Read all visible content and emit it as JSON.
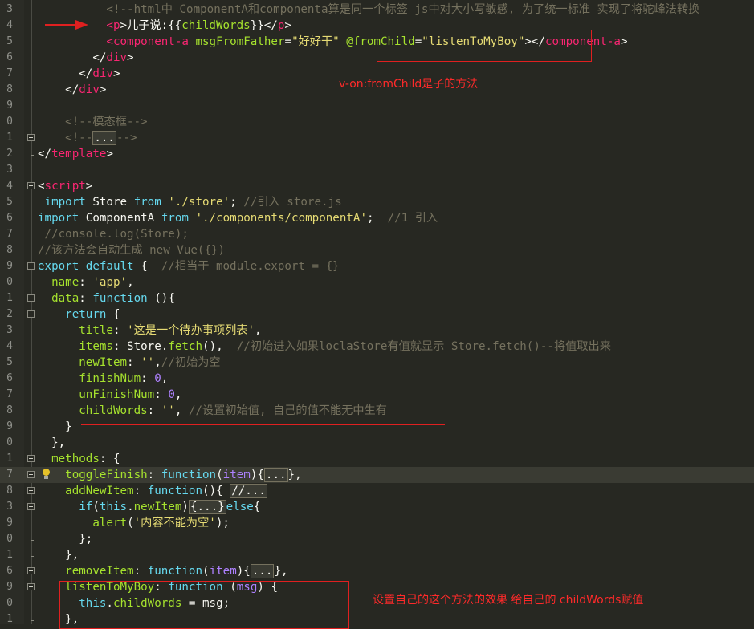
{
  "editor": {
    "lines": [
      {
        "num": "3",
        "fold": "",
        "segs": [
          [
            "p",
            "          "
          ],
          [
            "c",
            "<!--html中 ComponentA和componenta算是同一个标签 js中对大小写敏感, 为了统一标准 实现了将驼峰法转换"
          ]
        ]
      },
      {
        "num": "4",
        "fold": "",
        "segs": [
          [
            "p",
            "          "
          ],
          [
            "t",
            "<p"
          ],
          [
            "p",
            ">儿子说:{{"
          ],
          [
            "a",
            "childWords"
          ],
          [
            "p",
            "}}</"
          ],
          [
            "t",
            "p"
          ],
          [
            "p",
            ">"
          ]
        ]
      },
      {
        "num": "5",
        "fold": "",
        "segs": [
          [
            "p",
            "          "
          ],
          [
            "t",
            "<component-a"
          ],
          [
            "p",
            " "
          ],
          [
            "a",
            "msgFromFather"
          ],
          [
            "p",
            "="
          ],
          [
            "s",
            "\"好好干\""
          ],
          [
            "p",
            " "
          ],
          [
            "a",
            "@fromChild"
          ],
          [
            "p",
            "="
          ],
          [
            "s",
            "\"listenToMyBoy\""
          ],
          [
            "p",
            ">"
          ],
          [
            "p",
            "</"
          ],
          [
            "t",
            "component-a"
          ],
          [
            "p",
            ">"
          ]
        ]
      },
      {
        "num": "6",
        "fold": "end",
        "segs": [
          [
            "p",
            "        </"
          ],
          [
            "t",
            "div"
          ],
          [
            "p",
            ">"
          ]
        ]
      },
      {
        "num": "7",
        "fold": "end",
        "segs": [
          [
            "p",
            "      </"
          ],
          [
            "t",
            "div"
          ],
          [
            "p",
            ">"
          ]
        ]
      },
      {
        "num": "8",
        "fold": "end",
        "segs": [
          [
            "p",
            "    </"
          ],
          [
            "t",
            "div"
          ],
          [
            "p",
            ">"
          ]
        ]
      },
      {
        "num": "9",
        "fold": "",
        "segs": []
      },
      {
        "num": "0",
        "fold": "",
        "segs": [
          [
            "p",
            "    "
          ],
          [
            "c",
            "<!--模态框-->"
          ]
        ]
      },
      {
        "num": "1",
        "fold": "plus",
        "segs": [
          [
            "p",
            "    "
          ],
          [
            "c",
            "<!--"
          ],
          [
            "fold",
            "..."
          ],
          [
            "c",
            "-->"
          ]
        ]
      },
      {
        "num": "2",
        "fold": "end",
        "segs": [
          [
            "p",
            "</"
          ],
          [
            "t",
            "template"
          ],
          [
            "p",
            ">"
          ]
        ]
      },
      {
        "num": "3",
        "fold": "",
        "segs": []
      },
      {
        "num": "4",
        "fold": "minus",
        "segs": [
          [
            "p",
            "<"
          ],
          [
            "t",
            "script"
          ],
          [
            "p",
            ">"
          ]
        ]
      },
      {
        "num": "5",
        "fold": "",
        "segs": [
          [
            "p",
            " "
          ],
          [
            "k",
            "import"
          ],
          [
            "p",
            " Store "
          ],
          [
            "k",
            "from"
          ],
          [
            "p",
            " "
          ],
          [
            "s",
            "'./store'"
          ],
          [
            "p",
            "; "
          ],
          [
            "c",
            "//引入 store.js"
          ]
        ]
      },
      {
        "num": "6",
        "fold": "",
        "segs": [
          [
            "k",
            "import"
          ],
          [
            "p",
            " ComponentA "
          ],
          [
            "k",
            "from"
          ],
          [
            "p",
            " "
          ],
          [
            "s",
            "'./components/componentA'"
          ],
          [
            "p",
            ";  "
          ],
          [
            "c",
            "//1 引入"
          ]
        ]
      },
      {
        "num": "7",
        "fold": "",
        "segs": [
          [
            "c",
            " //console.log(Store);"
          ]
        ]
      },
      {
        "num": "8",
        "fold": "",
        "segs": [
          [
            "c",
            "//该方法会自动生成 new Vue({})"
          ]
        ]
      },
      {
        "num": "9",
        "fold": "minus",
        "segs": [
          [
            "k",
            "export"
          ],
          [
            "p",
            " "
          ],
          [
            "k",
            "default"
          ],
          [
            "p",
            " {  "
          ],
          [
            "c",
            "//相当于 module.export = {}"
          ]
        ]
      },
      {
        "num": "0",
        "fold": "",
        "segs": [
          [
            "p",
            "  "
          ],
          [
            "prop",
            "name"
          ],
          [
            "p",
            ": "
          ],
          [
            "s",
            "'app'"
          ],
          [
            "p",
            ","
          ]
        ]
      },
      {
        "num": "1",
        "fold": "minus",
        "segs": [
          [
            "p",
            "  "
          ],
          [
            "prop",
            "data"
          ],
          [
            "p",
            ": "
          ],
          [
            "k",
            "function"
          ],
          [
            "p",
            " (){"
          ]
        ]
      },
      {
        "num": "2",
        "fold": "minus",
        "segs": [
          [
            "p",
            "    "
          ],
          [
            "k",
            "return"
          ],
          [
            "p",
            " {"
          ]
        ]
      },
      {
        "num": "3",
        "fold": "",
        "segs": [
          [
            "p",
            "      "
          ],
          [
            "prop",
            "title"
          ],
          [
            "p",
            ": "
          ],
          [
            "s",
            "'这是一个待办事项列表'"
          ],
          [
            "p",
            ","
          ]
        ]
      },
      {
        "num": "4",
        "fold": "",
        "segs": [
          [
            "p",
            "      "
          ],
          [
            "prop",
            "items"
          ],
          [
            "p",
            ": Store."
          ],
          [
            "fn",
            "fetch"
          ],
          [
            "p",
            "(),  "
          ],
          [
            "c",
            "//初始进入如果loclaStore有值就显示 Store.fetch()--将值取出来"
          ]
        ]
      },
      {
        "num": "5",
        "fold": "",
        "segs": [
          [
            "p",
            "      "
          ],
          [
            "prop",
            "newItem"
          ],
          [
            "p",
            ": "
          ],
          [
            "s",
            "''"
          ],
          [
            "p",
            ","
          ],
          [
            "c",
            "//初始为空"
          ]
        ]
      },
      {
        "num": "6",
        "fold": "",
        "segs": [
          [
            "p",
            "      "
          ],
          [
            "prop",
            "finishNum"
          ],
          [
            "p",
            ": "
          ],
          [
            "n",
            "0"
          ],
          [
            "p",
            ","
          ]
        ]
      },
      {
        "num": "7",
        "fold": "",
        "segs": [
          [
            "p",
            "      "
          ],
          [
            "prop",
            "unFinishNum"
          ],
          [
            "p",
            ": "
          ],
          [
            "n",
            "0"
          ],
          [
            "p",
            ","
          ]
        ]
      },
      {
        "num": "8",
        "fold": "",
        "segs": [
          [
            "p",
            "      "
          ],
          [
            "prop",
            "childWords"
          ],
          [
            "p",
            ": "
          ],
          [
            "s",
            "''"
          ],
          [
            "p",
            ", "
          ],
          [
            "c",
            "//设置初始值, 自己的值不能无中生有"
          ]
        ]
      },
      {
        "num": "9",
        "fold": "end",
        "segs": [
          [
            "p",
            "    }"
          ]
        ]
      },
      {
        "num": "0",
        "fold": "end",
        "segs": [
          [
            "p",
            "  },"
          ]
        ]
      },
      {
        "num": "1",
        "fold": "minus",
        "segs": [
          [
            "p",
            "  "
          ],
          [
            "prop",
            "methods"
          ],
          [
            "p",
            ": {"
          ]
        ]
      },
      {
        "num": "7",
        "fold": "plus",
        "hl": true,
        "bulb": true,
        "segs": [
          [
            "p",
            "    "
          ],
          [
            "prop",
            "toggleFinish"
          ],
          [
            "p",
            ": "
          ],
          [
            "k",
            "function"
          ],
          [
            "p",
            "("
          ],
          [
            "n",
            "item"
          ],
          [
            "p",
            "){"
          ],
          [
            "fold",
            "..."
          ],
          [
            "p",
            "},"
          ]
        ]
      },
      {
        "num": "8",
        "fold": "minus",
        "segs": [
          [
            "p",
            "    "
          ],
          [
            "prop",
            "addNewItem"
          ],
          [
            "p",
            ": "
          ],
          [
            "k",
            "function"
          ],
          [
            "p",
            "(){ "
          ],
          [
            "fold",
            "//..."
          ]
        ]
      },
      {
        "num": "3",
        "fold": "plus",
        "segs": [
          [
            "p",
            "      "
          ],
          [
            "k",
            "if"
          ],
          [
            "p",
            "("
          ],
          [
            "k",
            "this"
          ],
          [
            "p",
            "."
          ],
          [
            "prop",
            "newItem"
          ],
          [
            "p",
            ")"
          ],
          [
            "fold",
            "{...}"
          ],
          [
            "k",
            "else"
          ],
          [
            "p",
            "{"
          ]
        ]
      },
      {
        "num": "9",
        "fold": "",
        "segs": [
          [
            "p",
            "        "
          ],
          [
            "fn",
            "alert"
          ],
          [
            "p",
            "("
          ],
          [
            "s",
            "'内容不能为空'"
          ],
          [
            "p",
            ");"
          ]
        ]
      },
      {
        "num": "0",
        "fold": "end",
        "segs": [
          [
            "p",
            "      };"
          ]
        ]
      },
      {
        "num": "1",
        "fold": "end",
        "segs": [
          [
            "p",
            "    },"
          ]
        ]
      },
      {
        "num": "6",
        "fold": "plus",
        "segs": [
          [
            "p",
            "    "
          ],
          [
            "prop",
            "removeItem"
          ],
          [
            "p",
            ": "
          ],
          [
            "k",
            "function"
          ],
          [
            "p",
            "("
          ],
          [
            "n",
            "item"
          ],
          [
            "p",
            "){"
          ],
          [
            "fold",
            "..."
          ],
          [
            "p",
            "},"
          ]
        ]
      },
      {
        "num": "9",
        "fold": "minus",
        "segs": [
          [
            "p",
            "    "
          ],
          [
            "prop",
            "listenToMyBoy"
          ],
          [
            "p",
            ": "
          ],
          [
            "k",
            "function"
          ],
          [
            "p",
            " ("
          ],
          [
            "n",
            "msg"
          ],
          [
            "p",
            ") {"
          ]
        ]
      },
      {
        "num": "0",
        "fold": "",
        "segs": [
          [
            "p",
            "      "
          ],
          [
            "k",
            "this"
          ],
          [
            "p",
            "."
          ],
          [
            "prop",
            "childWords"
          ],
          [
            "p",
            " = "
          ],
          [
            "p",
            "msg"
          ],
          [
            "p",
            ";"
          ]
        ]
      },
      {
        "num": "1",
        "fold": "end",
        "segs": [
          [
            "p",
            "    },"
          ]
        ]
      }
    ]
  },
  "annotations": {
    "v_on_note": "v-on:fromChild是子的方法",
    "set_note": "设置自己的这个方法的效果 给自己的 childWords赋值"
  },
  "colors": {
    "annotation": "#e02020",
    "background": "#272822"
  }
}
